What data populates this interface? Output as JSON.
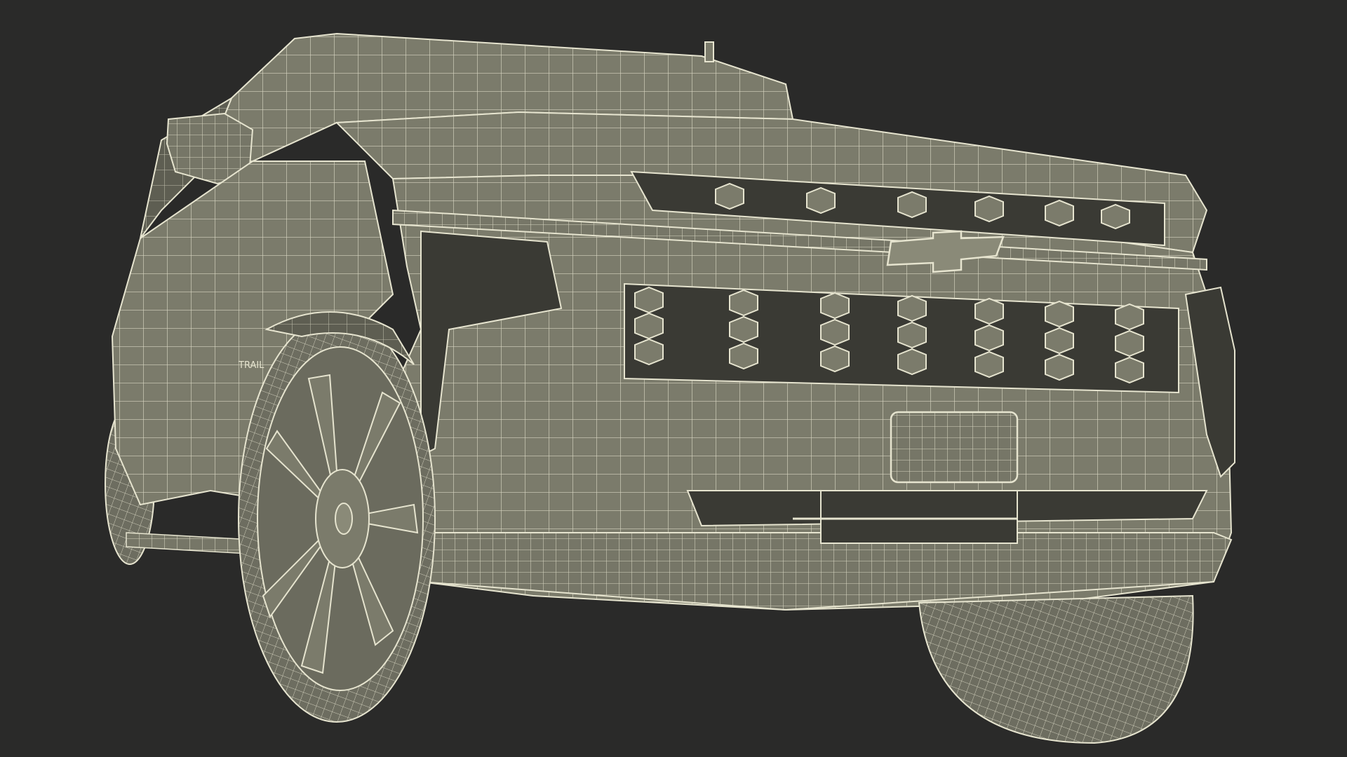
{
  "scene": {
    "subject": "wireframe-pickup-truck-front-three-quarter",
    "background_color": "#2a2a29",
    "surface_color": "#7b7b6b",
    "surface_shade_color": "#5e5e52",
    "wire_color": "#e6e4cf",
    "cavity_color": "#3a3a34",
    "badge_text": "TRAIL"
  }
}
